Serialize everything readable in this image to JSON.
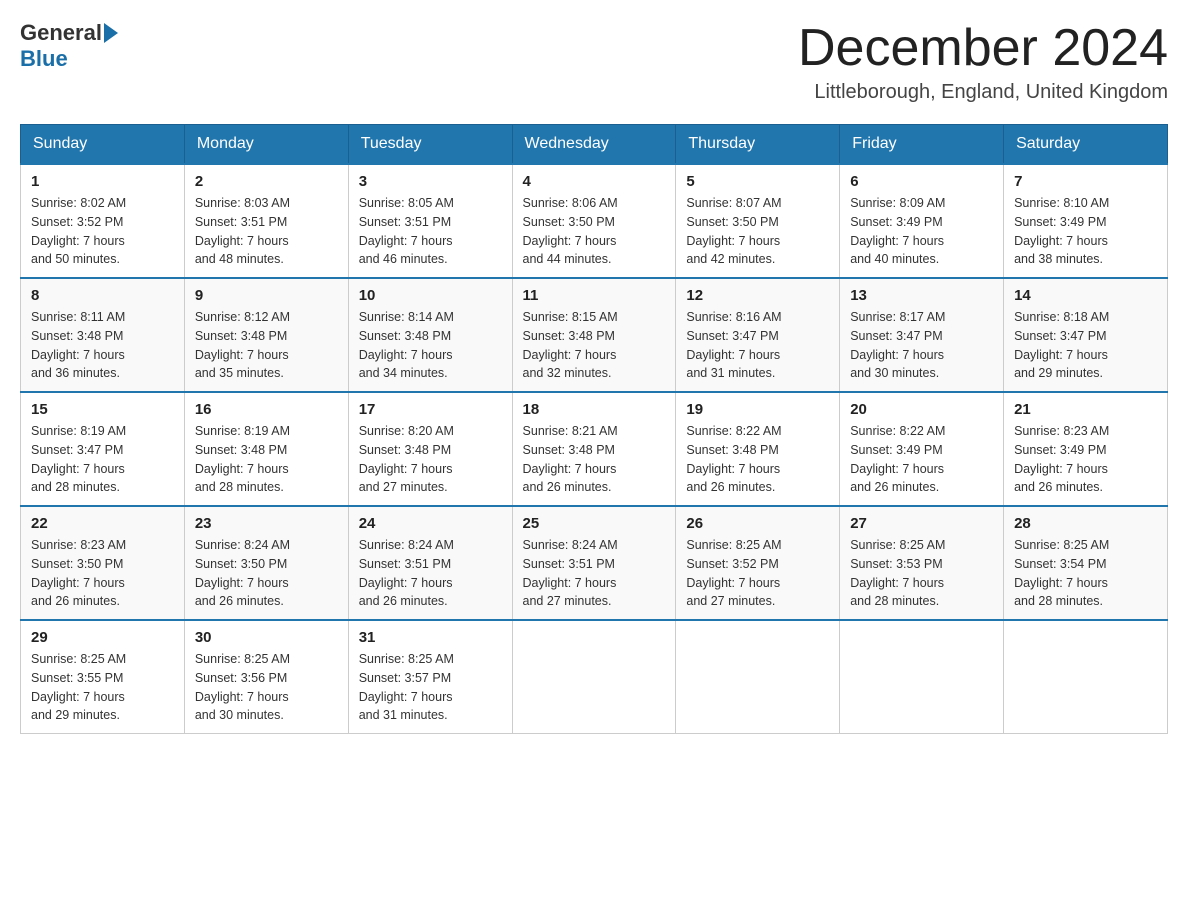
{
  "header": {
    "logo_general": "General",
    "logo_blue": "Blue",
    "title": "December 2024",
    "subtitle": "Littleborough, England, United Kingdom"
  },
  "weekdays": [
    "Sunday",
    "Monday",
    "Tuesday",
    "Wednesday",
    "Thursday",
    "Friday",
    "Saturday"
  ],
  "weeks": [
    [
      {
        "day": "1",
        "sunrise": "8:02 AM",
        "sunset": "3:52 PM",
        "daylight": "7 hours and 50 minutes."
      },
      {
        "day": "2",
        "sunrise": "8:03 AM",
        "sunset": "3:51 PM",
        "daylight": "7 hours and 48 minutes."
      },
      {
        "day": "3",
        "sunrise": "8:05 AM",
        "sunset": "3:51 PM",
        "daylight": "7 hours and 46 minutes."
      },
      {
        "day": "4",
        "sunrise": "8:06 AM",
        "sunset": "3:50 PM",
        "daylight": "7 hours and 44 minutes."
      },
      {
        "day": "5",
        "sunrise": "8:07 AM",
        "sunset": "3:50 PM",
        "daylight": "7 hours and 42 minutes."
      },
      {
        "day": "6",
        "sunrise": "8:09 AM",
        "sunset": "3:49 PM",
        "daylight": "7 hours and 40 minutes."
      },
      {
        "day": "7",
        "sunrise": "8:10 AM",
        "sunset": "3:49 PM",
        "daylight": "7 hours and 38 minutes."
      }
    ],
    [
      {
        "day": "8",
        "sunrise": "8:11 AM",
        "sunset": "3:48 PM",
        "daylight": "7 hours and 36 minutes."
      },
      {
        "day": "9",
        "sunrise": "8:12 AM",
        "sunset": "3:48 PM",
        "daylight": "7 hours and 35 minutes."
      },
      {
        "day": "10",
        "sunrise": "8:14 AM",
        "sunset": "3:48 PM",
        "daylight": "7 hours and 34 minutes."
      },
      {
        "day": "11",
        "sunrise": "8:15 AM",
        "sunset": "3:48 PM",
        "daylight": "7 hours and 32 minutes."
      },
      {
        "day": "12",
        "sunrise": "8:16 AM",
        "sunset": "3:47 PM",
        "daylight": "7 hours and 31 minutes."
      },
      {
        "day": "13",
        "sunrise": "8:17 AM",
        "sunset": "3:47 PM",
        "daylight": "7 hours and 30 minutes."
      },
      {
        "day": "14",
        "sunrise": "8:18 AM",
        "sunset": "3:47 PM",
        "daylight": "7 hours and 29 minutes."
      }
    ],
    [
      {
        "day": "15",
        "sunrise": "8:19 AM",
        "sunset": "3:47 PM",
        "daylight": "7 hours and 28 minutes."
      },
      {
        "day": "16",
        "sunrise": "8:19 AM",
        "sunset": "3:48 PM",
        "daylight": "7 hours and 28 minutes."
      },
      {
        "day": "17",
        "sunrise": "8:20 AM",
        "sunset": "3:48 PM",
        "daylight": "7 hours and 27 minutes."
      },
      {
        "day": "18",
        "sunrise": "8:21 AM",
        "sunset": "3:48 PM",
        "daylight": "7 hours and 26 minutes."
      },
      {
        "day": "19",
        "sunrise": "8:22 AM",
        "sunset": "3:48 PM",
        "daylight": "7 hours and 26 minutes."
      },
      {
        "day": "20",
        "sunrise": "8:22 AM",
        "sunset": "3:49 PM",
        "daylight": "7 hours and 26 minutes."
      },
      {
        "day": "21",
        "sunrise": "8:23 AM",
        "sunset": "3:49 PM",
        "daylight": "7 hours and 26 minutes."
      }
    ],
    [
      {
        "day": "22",
        "sunrise": "8:23 AM",
        "sunset": "3:50 PM",
        "daylight": "7 hours and 26 minutes."
      },
      {
        "day": "23",
        "sunrise": "8:24 AM",
        "sunset": "3:50 PM",
        "daylight": "7 hours and 26 minutes."
      },
      {
        "day": "24",
        "sunrise": "8:24 AM",
        "sunset": "3:51 PM",
        "daylight": "7 hours and 26 minutes."
      },
      {
        "day": "25",
        "sunrise": "8:24 AM",
        "sunset": "3:51 PM",
        "daylight": "7 hours and 27 minutes."
      },
      {
        "day": "26",
        "sunrise": "8:25 AM",
        "sunset": "3:52 PM",
        "daylight": "7 hours and 27 minutes."
      },
      {
        "day": "27",
        "sunrise": "8:25 AM",
        "sunset": "3:53 PM",
        "daylight": "7 hours and 28 minutes."
      },
      {
        "day": "28",
        "sunrise": "8:25 AM",
        "sunset": "3:54 PM",
        "daylight": "7 hours and 28 minutes."
      }
    ],
    [
      {
        "day": "29",
        "sunrise": "8:25 AM",
        "sunset": "3:55 PM",
        "daylight": "7 hours and 29 minutes."
      },
      {
        "day": "30",
        "sunrise": "8:25 AM",
        "sunset": "3:56 PM",
        "daylight": "7 hours and 30 minutes."
      },
      {
        "day": "31",
        "sunrise": "8:25 AM",
        "sunset": "3:57 PM",
        "daylight": "7 hours and 31 minutes."
      },
      null,
      null,
      null,
      null
    ]
  ],
  "labels": {
    "sunrise": "Sunrise:",
    "sunset": "Sunset:",
    "daylight": "Daylight:"
  },
  "accent_color": "#2176ae"
}
